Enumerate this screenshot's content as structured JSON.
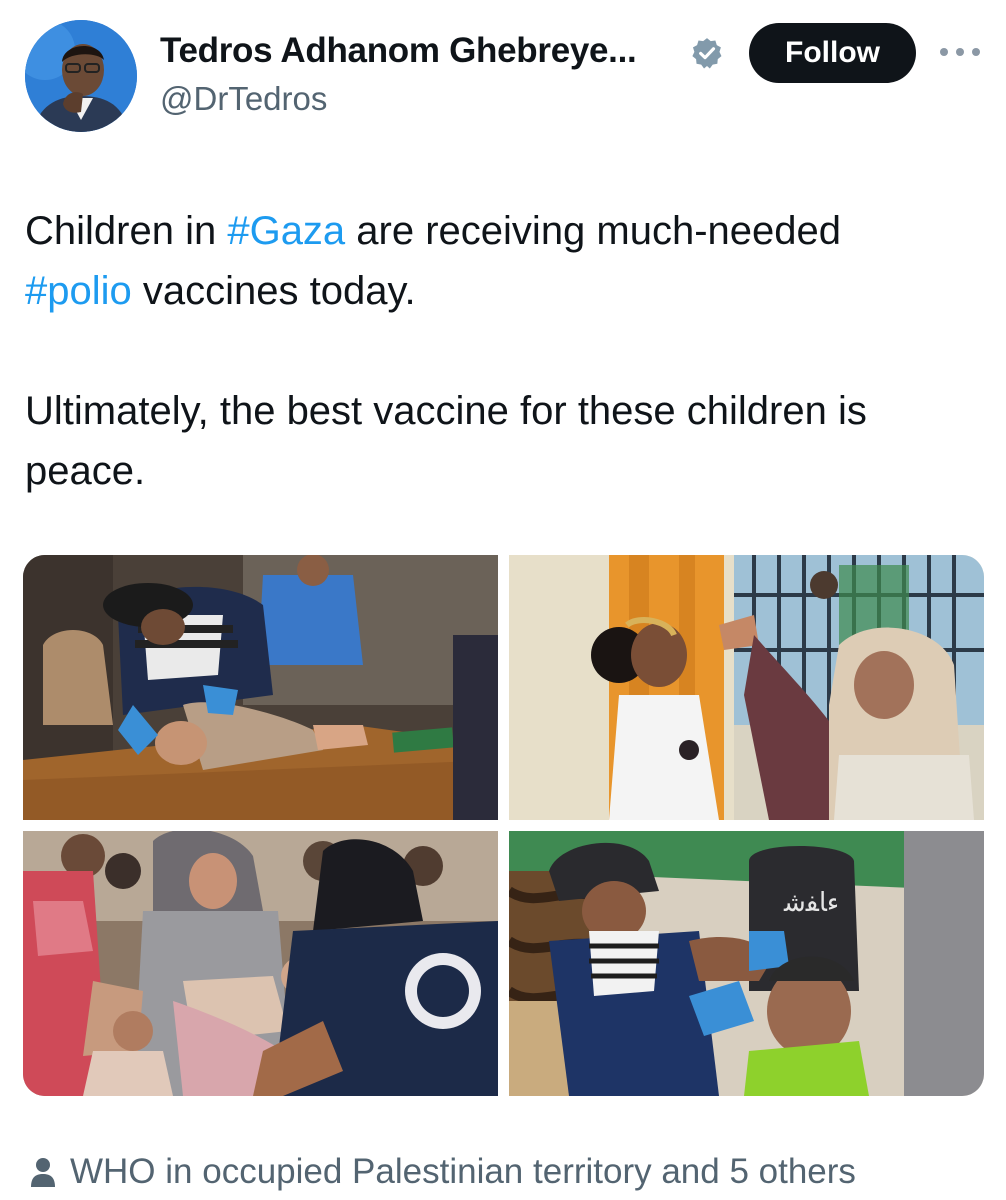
{
  "author": {
    "display_name": "Tedros Adhanom Ghebreye...",
    "handle": "@DrTedros",
    "verified": true,
    "avatar_icon": "profile-photo"
  },
  "actions": {
    "follow_label": "Follow",
    "more_icon": "more-horizontal-icon"
  },
  "tweet": {
    "line1_pre": "Children in ",
    "hashtag1": "#Gaza",
    "line1_post": " are receiving much-needed ",
    "hashtag2": "#polio",
    "line1_end": " vaccines today.",
    "line2": "Ultimately, the best vaccine for these children is peace."
  },
  "media": {
    "photos": [
      {
        "description_icon": "photo-baby-vaccination"
      },
      {
        "description_icon": "photo-girl-vaccination"
      },
      {
        "description_icon": "photo-crowd-vaccination"
      },
      {
        "description_icon": "photo-boy-vaccination"
      }
    ]
  },
  "social_context": {
    "icon": "person-icon",
    "text": "WHO in occupied Palestinian territory and 5 others"
  },
  "colors": {
    "hashtag": "#1d9bf0",
    "follow_bg": "#0f1419",
    "secondary_text": "#536471",
    "verified_badge": "#829aab"
  }
}
